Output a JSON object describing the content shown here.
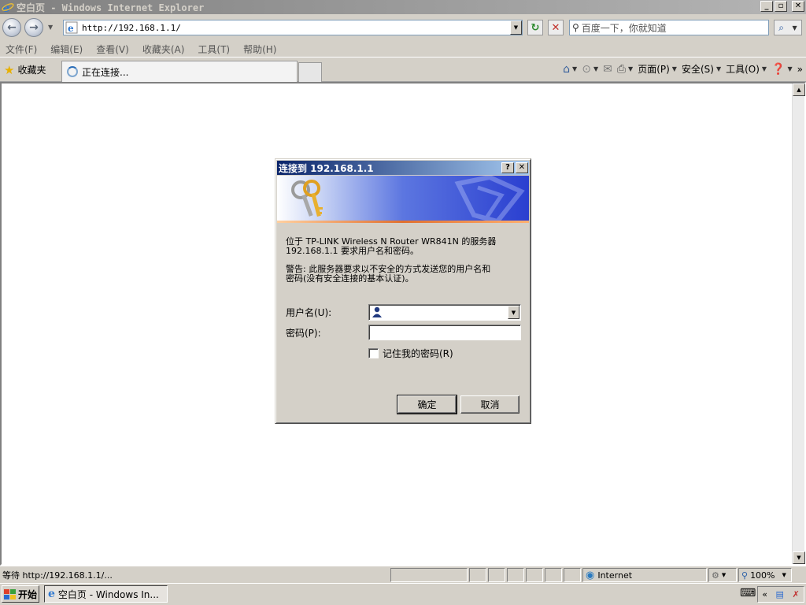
{
  "window": {
    "title": "空白页 - Windows Internet Explorer",
    "min_label": "_",
    "max_label": "▫",
    "close_label": "✕"
  },
  "toolbar": {
    "back_icon": "back-arrow-icon",
    "forward_icon": "forward-arrow-icon",
    "address_value": "http://192.168.1.1/",
    "refresh_label": "↻",
    "stop_label": "✕",
    "search_placeholder": "百度一下，你就知道",
    "search_go_label": "⌕"
  },
  "menu": {
    "items": [
      "文件(F)",
      "编辑(E)",
      "查看(V)",
      "收藏夹(A)",
      "工具(T)",
      "帮助(H)"
    ]
  },
  "favbar": {
    "favorites_label": "收藏夹",
    "tab_label": "正在连接..."
  },
  "commandbar": {
    "page_label": "页面(P)",
    "safety_label": "安全(S)",
    "tools_label": "工具(O)",
    "more_label": "»"
  },
  "dialog": {
    "title": "连接到 192.168.1.1",
    "help_label": "?",
    "close_label": "✕",
    "message_line1": "位于 TP-LINK Wireless N Router WR841N 的服务器",
    "message_line2": "192.168.1.1 要求用户名和密码。",
    "warning_line1": "警告: 此服务器要求以不安全的方式发送您的用户名和",
    "warning_line2": "密码(没有安全连接的基本认证)。",
    "username_label": "用户名(U):",
    "username_value": "",
    "password_label": "密码(P):",
    "password_value": "",
    "remember_label": "记住我的密码(R)",
    "ok_label": "确定",
    "cancel_label": "取消"
  },
  "statusbar": {
    "status_text": "等待 http://192.168.1.1/...",
    "zone_label": "Internet",
    "zoom_label": "100%"
  },
  "taskbar": {
    "start_label": "开始",
    "task_label": "空白页 - Windows In...",
    "tray_chevron": "«"
  },
  "colors": {
    "dialog_title_start": "#0a246a",
    "dialog_title_end": "#a6caf0",
    "banner_blue": "#2a3fd0",
    "face": "#d4d0c8"
  }
}
